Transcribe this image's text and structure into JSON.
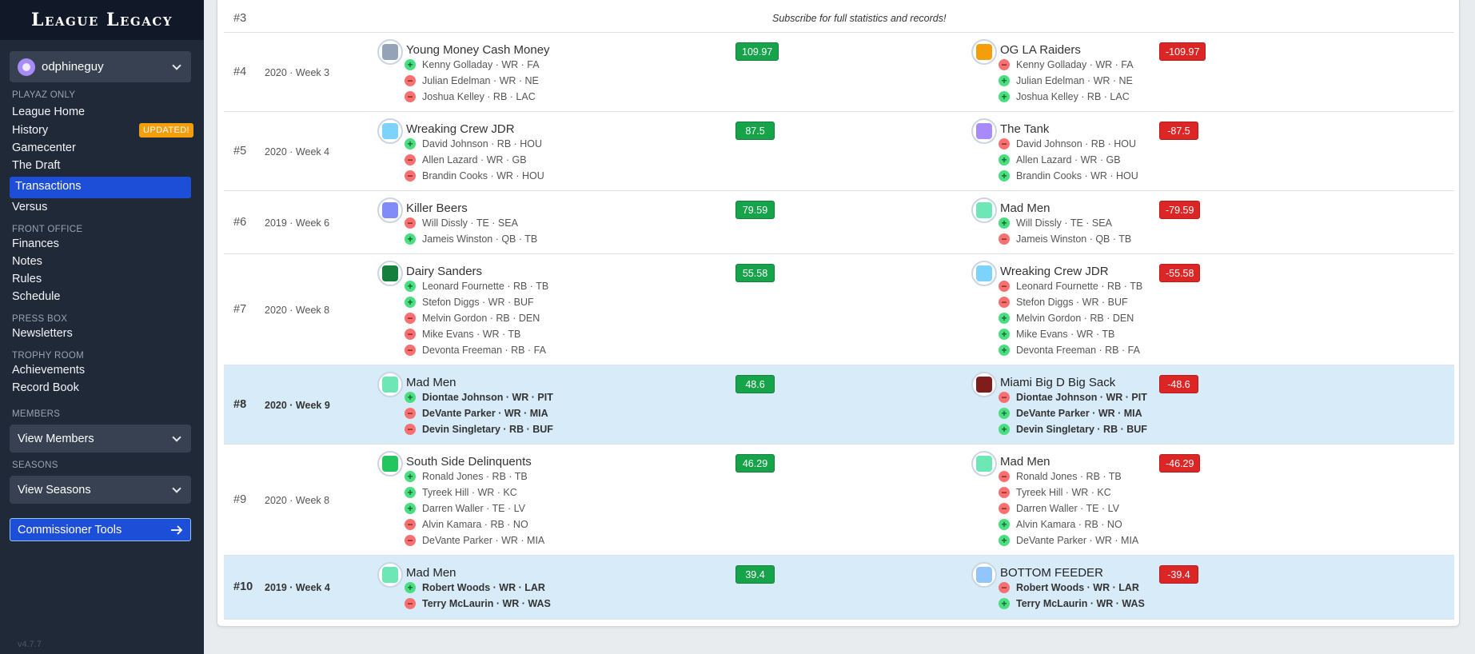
{
  "app": {
    "logo": "League Legacy",
    "version": "v4.7.7"
  },
  "user": {
    "name": "odphineguy"
  },
  "sidebar": {
    "sections": {
      "playaz": "PLAYAZ ONLY",
      "front_office": "FRONT OFFICE",
      "press_box": "PRESS BOX",
      "trophy_room": "TROPHY ROOM",
      "members": "MEMBERS",
      "seasons": "SEASONS"
    },
    "items": {
      "league_home": "League Home",
      "history": "History",
      "gamecenter": "Gamecenter",
      "draft": "The Draft",
      "transactions": "Transactions",
      "versus": "Versus",
      "finances": "Finances",
      "notes": "Notes",
      "rules": "Rules",
      "schedule": "Schedule",
      "newsletters": "Newsletters",
      "achievements": "Achievements",
      "record_book": "Record Book"
    },
    "badge_updated": "UPDATED!",
    "view_members": "View Members",
    "view_seasons": "View Seasons",
    "commissioner_tools": "Commissioner Tools"
  },
  "colors": {
    "accent": "#1d4ed8",
    "positive": "#16a34a",
    "negative": "#dc2626",
    "highlight_row": "#d7ecf8",
    "sidebar_bg": "#1f2937"
  },
  "subscribe_row": {
    "rank": "#3",
    "text": "Subscribe for full statistics and records!"
  },
  "trades": [
    {
      "rank": "#4",
      "week": "2020 · Week 3",
      "highlight": false,
      "left": {
        "team": "Young Money Cash Money",
        "avatar_color": "#94a3b8",
        "score": "109.97",
        "players": [
          {
            "sign": "+",
            "text": "Kenny Golladay · WR · FA"
          },
          {
            "sign": "-",
            "text": "Julian Edelman · WR · NE"
          },
          {
            "sign": "-",
            "text": "Joshua Kelley · RB · LAC"
          }
        ]
      },
      "right": {
        "team": "OG LA Raiders",
        "avatar_color": "#f59e0b",
        "score": "-109.97",
        "players": [
          {
            "sign": "-",
            "text": "Kenny Golladay · WR · FA"
          },
          {
            "sign": "+",
            "text": "Julian Edelman · WR · NE"
          },
          {
            "sign": "+",
            "text": "Joshua Kelley · RB · LAC"
          }
        ]
      }
    },
    {
      "rank": "#5",
      "week": "2020 · Week 4",
      "highlight": false,
      "left": {
        "team": "Wreaking Crew JDR",
        "avatar_color": "#7dd3fc",
        "score": "87.5",
        "players": [
          {
            "sign": "+",
            "text": "David Johnson · RB · HOU"
          },
          {
            "sign": "-",
            "text": "Allen Lazard · WR · GB"
          },
          {
            "sign": "-",
            "text": "Brandin Cooks · WR · HOU"
          }
        ]
      },
      "right": {
        "team": "The Tank",
        "avatar_color": "#a78bfa",
        "score": "-87.5",
        "players": [
          {
            "sign": "-",
            "text": "David Johnson · RB · HOU"
          },
          {
            "sign": "+",
            "text": "Allen Lazard · WR · GB"
          },
          {
            "sign": "+",
            "text": "Brandin Cooks · WR · HOU"
          }
        ]
      }
    },
    {
      "rank": "#6",
      "week": "2019 · Week 6",
      "highlight": false,
      "left": {
        "team": "Killer Beers",
        "avatar_color": "#818cf8",
        "score": "79.59",
        "players": [
          {
            "sign": "-",
            "text": "Will Dissly · TE · SEA"
          },
          {
            "sign": "+",
            "text": "Jameis Winston · QB · TB"
          }
        ]
      },
      "right": {
        "team": "Mad Men",
        "avatar_color": "#6ee7b7",
        "score": "-79.59",
        "players": [
          {
            "sign": "+",
            "text": "Will Dissly · TE · SEA"
          },
          {
            "sign": "-",
            "text": "Jameis Winston · QB · TB"
          }
        ]
      }
    },
    {
      "rank": "#7",
      "week": "2020 · Week 8",
      "highlight": false,
      "left": {
        "team": "Dairy Sanders",
        "avatar_color": "#15803d",
        "score": "55.58",
        "players": [
          {
            "sign": "+",
            "text": "Leonard Fournette · RB · TB"
          },
          {
            "sign": "+",
            "text": "Stefon Diggs · WR · BUF"
          },
          {
            "sign": "-",
            "text": "Melvin Gordon · RB · DEN"
          },
          {
            "sign": "-",
            "text": "Mike Evans · WR · TB"
          },
          {
            "sign": "-",
            "text": "Devonta Freeman · RB · FA"
          }
        ]
      },
      "right": {
        "team": "Wreaking Crew JDR",
        "avatar_color": "#7dd3fc",
        "score": "-55.58",
        "players": [
          {
            "sign": "-",
            "text": "Leonard Fournette · RB · TB"
          },
          {
            "sign": "-",
            "text": "Stefon Diggs · WR · BUF"
          },
          {
            "sign": "+",
            "text": "Melvin Gordon · RB · DEN"
          },
          {
            "sign": "+",
            "text": "Mike Evans · WR · TB"
          },
          {
            "sign": "+",
            "text": "Devonta Freeman · RB · FA"
          }
        ]
      }
    },
    {
      "rank": "#8",
      "week": "2020 · Week 9",
      "highlight": true,
      "left": {
        "team": "Mad Men",
        "avatar_color": "#6ee7b7",
        "score": "48.6",
        "players": [
          {
            "sign": "+",
            "text": "Diontae Johnson · WR · PIT"
          },
          {
            "sign": "-",
            "text": "DeVante Parker · WR · MIA"
          },
          {
            "sign": "-",
            "text": "Devin Singletary · RB · BUF"
          }
        ]
      },
      "right": {
        "team": "Miami Big D Big Sack",
        "avatar_color": "#7f1d1d",
        "score": "-48.6",
        "players": [
          {
            "sign": "-",
            "text": "Diontae Johnson · WR · PIT"
          },
          {
            "sign": "+",
            "text": "DeVante Parker · WR · MIA"
          },
          {
            "sign": "+",
            "text": "Devin Singletary · RB · BUF"
          }
        ]
      }
    },
    {
      "rank": "#9",
      "week": "2020 · Week 8",
      "highlight": false,
      "left": {
        "team": "South Side Delinquents",
        "avatar_color": "#22c55e",
        "score": "46.29",
        "players": [
          {
            "sign": "+",
            "text": "Ronald Jones · RB · TB"
          },
          {
            "sign": "+",
            "text": "Tyreek Hill · WR · KC"
          },
          {
            "sign": "+",
            "text": "Darren Waller · TE · LV"
          },
          {
            "sign": "-",
            "text": "Alvin Kamara · RB · NO"
          },
          {
            "sign": "-",
            "text": "DeVante Parker · WR · MIA"
          }
        ]
      },
      "right": {
        "team": "Mad Men",
        "avatar_color": "#6ee7b7",
        "score": "-46.29",
        "players": [
          {
            "sign": "-",
            "text": "Ronald Jones · RB · TB"
          },
          {
            "sign": "-",
            "text": "Tyreek Hill · WR · KC"
          },
          {
            "sign": "-",
            "text": "Darren Waller · TE · LV"
          },
          {
            "sign": "+",
            "text": "Alvin Kamara · RB · NO"
          },
          {
            "sign": "+",
            "text": "DeVante Parker · WR · MIA"
          }
        ]
      }
    },
    {
      "rank": "#10",
      "week": "2019 · Week 4",
      "highlight": true,
      "left": {
        "team": "Mad Men",
        "avatar_color": "#6ee7b7",
        "score": "39.4",
        "players": [
          {
            "sign": "+",
            "text": "Robert Woods · WR · LAR"
          },
          {
            "sign": "-",
            "text": "Terry McLaurin · WR · WAS"
          }
        ]
      },
      "right": {
        "team": "BOTTOM FEEDER",
        "avatar_color": "#93c5fd",
        "score": "-39.4",
        "players": [
          {
            "sign": "-",
            "text": "Robert Woods · WR · LAR"
          },
          {
            "sign": "+",
            "text": "Terry McLaurin · WR · WAS"
          }
        ]
      }
    }
  ]
}
